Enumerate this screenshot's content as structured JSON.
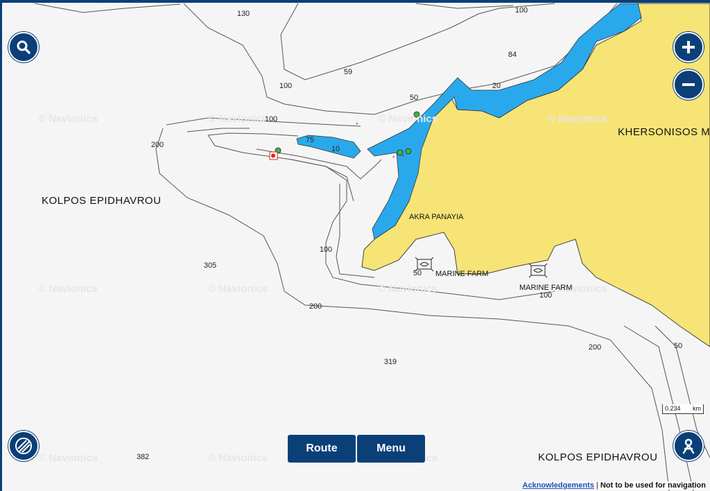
{
  "places": {
    "kolpos_west": "KOLPOS EPIDHAVROU",
    "kolpos_south": "KOLPOS EPIDHAVROU",
    "khersonisos": "KHERSONISOS M",
    "akra_panayia": "AKRA PANAYIA",
    "marine_farm_1": "MARINE FARM",
    "marine_farm_2": "MARINE FARM"
  },
  "depths": {
    "d130": "130",
    "d100_top": "100",
    "d84": "84",
    "d59": "59",
    "d100_a": "100",
    "d50_a": "50",
    "d20": "20",
    "d100_b": "100",
    "d200_left": "200",
    "d75": "75",
    "d10": "10",
    "d100_c": "100",
    "d305": "305",
    "d50_b": "50",
    "d200_mid": "200",
    "d100_d": "100",
    "d200_right": "200",
    "d50_c": "50",
    "d319": "319",
    "d382": "382"
  },
  "watermark": "© Navionics",
  "buttons": {
    "route": "Route",
    "menu": "Menu"
  },
  "scale_bar": {
    "value": "0.234",
    "unit": "km"
  },
  "footer": {
    "link": "Acknowledgements",
    "separator": " | ",
    "notice": "Not to be used for navigation"
  },
  "colors": {
    "land": "#f6e476",
    "shallow_water": "#29a9ec",
    "deep_water": "#f5f5f5",
    "contour": "#555555",
    "ui_blue": "#0b3f78"
  },
  "icons": [
    "search-icon",
    "zoom-in-icon",
    "zoom-out-icon",
    "layers-icon",
    "location-icon",
    "marine-farm-icon",
    "mooring-icon"
  ]
}
